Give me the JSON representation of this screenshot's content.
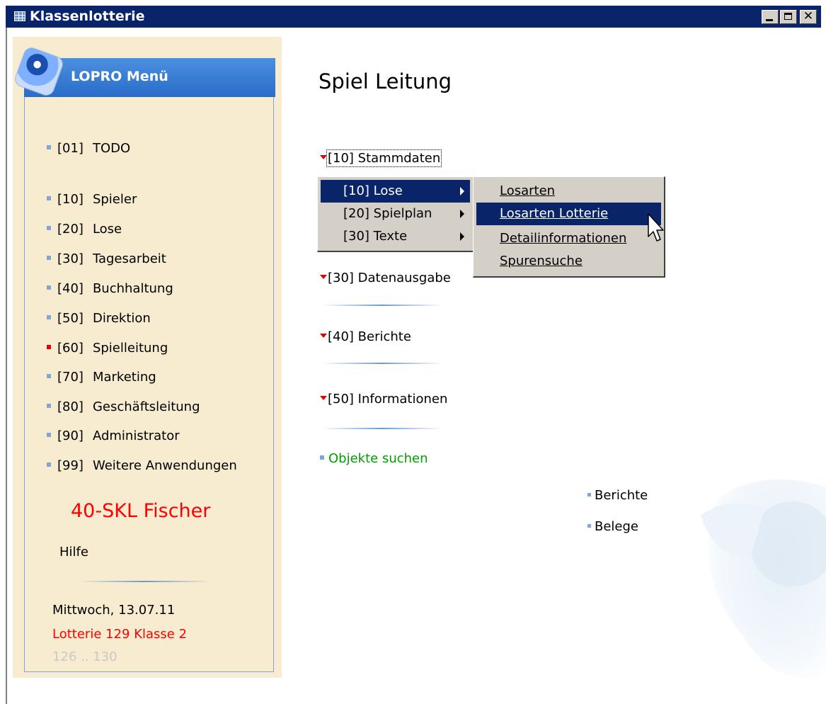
{
  "window": {
    "title": "Klassenlotterie",
    "controls": [
      "minimize",
      "maximize",
      "close"
    ]
  },
  "sidebar": {
    "header_title": "LOPRO Menü",
    "items": [
      {
        "code": "[01]",
        "label": "TODO",
        "active": false
      },
      {
        "code": "[10]",
        "label": "Spieler",
        "active": false
      },
      {
        "code": "[20]",
        "label": "Lose",
        "active": false
      },
      {
        "code": "[30]",
        "label": "Tagesarbeit",
        "active": false
      },
      {
        "code": "[40]",
        "label": "Buchhaltung",
        "active": false
      },
      {
        "code": "[50]",
        "label": "Direktion",
        "active": false
      },
      {
        "code": "[60]",
        "label": "Spielleitung",
        "active": true
      },
      {
        "code": "[70]",
        "label": "Marketing",
        "active": false
      },
      {
        "code": "[80]",
        "label": "Geschäftsleitung",
        "active": false
      },
      {
        "code": "[90]",
        "label": "Administrator",
        "active": false
      },
      {
        "code": "[99]",
        "label": "Weitere Anwendungen",
        "active": false
      }
    ],
    "company": "40-SKL Fischer",
    "help": "Hilfe",
    "date": "Mittwoch, 13.07.11",
    "lottery": "Lotterie 129 Klasse 2",
    "range": "126 .. 130"
  },
  "main": {
    "title": "Spiel Leitung",
    "sections": [
      {
        "label": "[10] Stammdaten",
        "focused": true
      },
      {
        "label": "[30] Datenausgabe",
        "focused": false
      },
      {
        "label": "[40] Berichte",
        "focused": false
      },
      {
        "label": "[50] Informationen",
        "focused": false
      }
    ],
    "search_link": "Objekte suchen",
    "right_links": [
      "Berichte",
      "Belege"
    ]
  },
  "popup_menu": {
    "items": [
      {
        "label": "[10]  Lose",
        "selected": true,
        "has_submenu": true
      },
      {
        "label": "[20]  Spielplan",
        "selected": false,
        "has_submenu": true
      },
      {
        "label": "[30]  Texte",
        "selected": false,
        "has_submenu": true
      }
    ]
  },
  "submenu": {
    "items": [
      {
        "label": "Losarten",
        "selected": false
      },
      {
        "label": "Losarten Lotterie",
        "selected": true
      },
      {
        "label": "Detailinformationen",
        "selected": false
      },
      {
        "label": "Spurensuche",
        "selected": false
      }
    ]
  },
  "colors": {
    "titlebar": "#0a246a",
    "sidebar_bg": "#f8ecd0",
    "menu_header": "#2a6cc8",
    "accent_red": "#ff0000",
    "link_green": "#00a000",
    "menu_bg": "#d4d0c8",
    "menu_selected": "#0a246a"
  }
}
